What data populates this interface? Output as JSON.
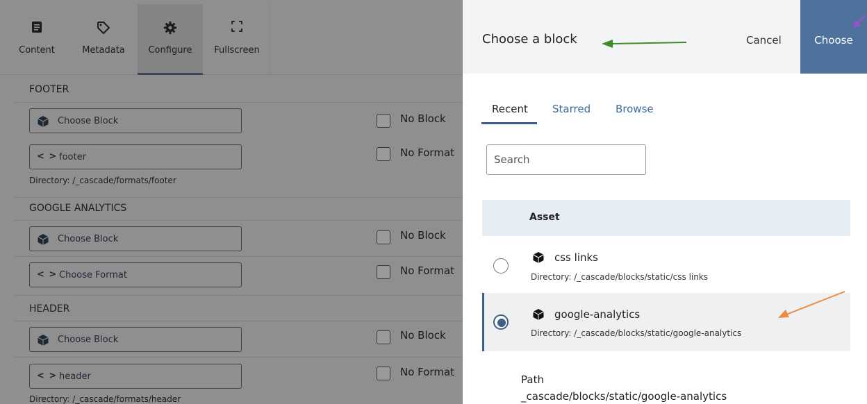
{
  "toolbar": {
    "items": [
      {
        "label": "Content",
        "icon": "content-icon"
      },
      {
        "label": "Metadata",
        "icon": "tag-icon"
      },
      {
        "label": "Configure",
        "icon": "gear-icon"
      },
      {
        "label": "Fullscreen",
        "icon": "fullscreen-icon"
      }
    ]
  },
  "sections": [
    {
      "title": "FOOTER",
      "block_label": "Choose Block",
      "no_block_label": "No Block",
      "format_code": "< >",
      "format_label": "footer",
      "no_format_label": "No Format",
      "directory": "Directory: /_cascade/formats/footer"
    },
    {
      "title": "GOOGLE ANALYTICS",
      "block_label": "Choose Block",
      "no_block_label": "No Block",
      "format_code": "< >",
      "format_label": "Choose Format",
      "no_format_label": "No Format"
    },
    {
      "title": "HEADER",
      "block_label": "Choose Block",
      "no_block_label": "No Block",
      "format_code": "< >",
      "format_label": "header",
      "no_format_label": "No Format",
      "directory": "Directory: /_cascade/formats/header"
    }
  ],
  "modal": {
    "title": "Choose a block",
    "cancel_label": "Cancel",
    "choose_label": "Choose",
    "tabs": [
      {
        "label": "Recent"
      },
      {
        "label": "Starred"
      },
      {
        "label": "Browse"
      }
    ],
    "search_placeholder": "Search",
    "column_header": "Asset",
    "rows": [
      {
        "name": "css links",
        "directory": "Directory: /_cascade/blocks/static/css links",
        "selected": false
      },
      {
        "name": "google-analytics",
        "directory": "Directory: /_cascade/blocks/static/google-analytics",
        "selected": true
      }
    ],
    "path_label": "Path",
    "path_value": "_cascade/blocks/static/google-analytics"
  },
  "colors": {
    "accent": "#4e729c",
    "tab_link": "#3d6a9e",
    "overlay": "#8f8f8f",
    "arrow_green": "#3f8a2a",
    "arrow_orange": "#f08a3c",
    "arrow_purple": "#9b4fd1"
  }
}
